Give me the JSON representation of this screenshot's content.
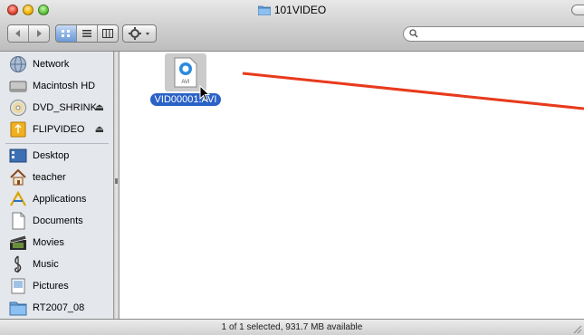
{
  "window": {
    "title": "101VIDEO"
  },
  "search": {
    "placeholder": "",
    "value": ""
  },
  "sidebar": {
    "devices": [
      {
        "label": "Network",
        "icon": "network-globe-icon",
        "eject": false
      },
      {
        "label": "Macintosh HD",
        "icon": "hard-drive-icon",
        "eject": false
      },
      {
        "label": "DVD_SHRINK",
        "icon": "dvd-icon",
        "eject": true
      },
      {
        "label": "FLIPVIDEO",
        "icon": "usb-drive-icon",
        "eject": true
      }
    ],
    "places": [
      {
        "label": "Desktop",
        "icon": "desktop-icon"
      },
      {
        "label": "teacher",
        "icon": "home-icon"
      },
      {
        "label": "Applications",
        "icon": "applications-icon"
      },
      {
        "label": "Documents",
        "icon": "documents-icon"
      },
      {
        "label": "Movies",
        "icon": "movies-icon"
      },
      {
        "label": "Music",
        "icon": "music-icon"
      },
      {
        "label": "Pictures",
        "icon": "pictures-icon"
      },
      {
        "label": "RT2007_08",
        "icon": "folder-icon"
      }
    ],
    "eject_symbol": "⏏"
  },
  "content": {
    "files": [
      {
        "name": "VID00001.AVI",
        "type_badge": "AVI",
        "selected": true
      }
    ]
  },
  "status": {
    "text": "1 of 1 selected, 931.7 MB available"
  },
  "colors": {
    "selection": "#2a62c6",
    "annotation_line": "#e83a1c",
    "sidebar_bg": "#e4e7ec"
  }
}
